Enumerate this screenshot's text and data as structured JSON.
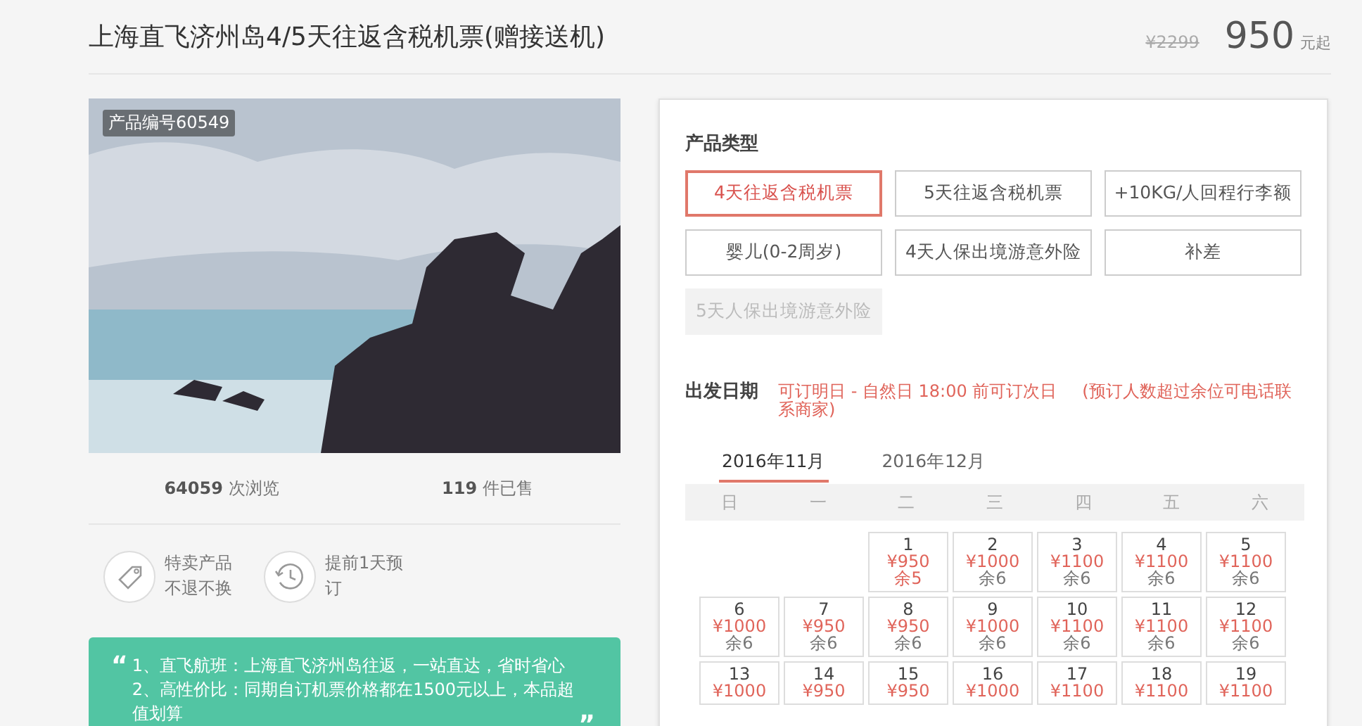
{
  "header": {
    "title": "上海直飞济州岛4/5天往返含税机票(赠接送机)",
    "original_price": "¥2299",
    "price": "950",
    "price_suffix": "元起"
  },
  "gallery": {
    "product_code": "产品编号60549"
  },
  "stats": [
    {
      "value": "64059",
      "label": "次浏览"
    },
    {
      "value": "119",
      "label": "件已售"
    }
  ],
  "features": [
    {
      "kind": "tag",
      "lines": [
        "特卖产品",
        "不退不换"
      ]
    },
    {
      "kind": "clock",
      "lines": [
        "提前1天预",
        "订"
      ]
    }
  ],
  "highlights": {
    "quote_open": "“",
    "quote_close": "”",
    "lines": [
      "1、直飞航班：上海直飞济州岛往返，一站直达，省时省心",
      "2、高性价比：同期自订机票价格都在1500元以上，本品超值划算"
    ]
  },
  "product_type": {
    "label": "产品类型",
    "options": [
      {
        "label": "4天往返含税机票",
        "selected": true,
        "disabled": false
      },
      {
        "label": "5天往返含税机票",
        "selected": false,
        "disabled": false
      },
      {
        "label": "+10KG/人回程行李额",
        "selected": false,
        "disabled": false
      },
      {
        "label": "婴儿(0-2周岁)",
        "selected": false,
        "disabled": false
      },
      {
        "label": "4天人保出境游意外险",
        "selected": false,
        "disabled": false
      },
      {
        "label": "补差",
        "selected": false,
        "disabled": false
      },
      {
        "label": "5天人保出境游意外险",
        "selected": false,
        "disabled": true
      }
    ]
  },
  "departure": {
    "label": "出发日期",
    "notice": "可订明日 - 自然日 18:00 前可订次日",
    "note": "(预订人数超过余位可电话联系商家)",
    "months": [
      {
        "label": "2016年11月",
        "selected": true
      },
      {
        "label": "2016年12月",
        "selected": false
      }
    ],
    "weekdays": [
      "日",
      "一",
      "二",
      "三",
      "四",
      "五",
      "六"
    ],
    "weeks": [
      [
        {
          "kind": "blank"
        },
        {
          "kind": "blank"
        },
        {
          "kind": "day",
          "date": "1",
          "price": "¥950",
          "remaining": "余5",
          "low": true
        },
        {
          "date": "2",
          "price": "¥1000",
          "remaining": "余6",
          "low": false
        },
        {
          "date": "3",
          "price": "¥1100",
          "remaining": "余6",
          "low": false
        },
        {
          "date": "4",
          "price": "¥1100",
          "remaining": "余6",
          "low": false
        },
        {
          "date": "5",
          "price": "¥1100",
          "remaining": "余6",
          "low": false
        }
      ],
      [
        {
          "date": "6",
          "price": "¥1000",
          "remaining": "余6",
          "low": false
        },
        {
          "date": "7",
          "price": "¥950",
          "remaining": "余6",
          "low": false
        },
        {
          "date": "8",
          "price": "¥950",
          "remaining": "余6",
          "low": false
        },
        {
          "date": "9",
          "price": "¥1000",
          "remaining": "余6",
          "low": false
        },
        {
          "date": "10",
          "price": "¥1100",
          "remaining": "余6",
          "low": false
        },
        {
          "date": "11",
          "price": "¥1100",
          "remaining": "余6",
          "low": false
        },
        {
          "date": "12",
          "price": "¥1100",
          "remaining": "余6",
          "low": false
        }
      ],
      [
        {
          "date": "13",
          "price": "¥1000"
        },
        {
          "date": "14",
          "price": "¥950"
        },
        {
          "date": "15",
          "price": "¥950"
        },
        {
          "date": "16",
          "price": "¥1000"
        },
        {
          "date": "17",
          "price": "¥1100"
        },
        {
          "date": "18",
          "price": "¥1100"
        },
        {
          "date": "19",
          "price": "¥1100"
        }
      ]
    ]
  }
}
